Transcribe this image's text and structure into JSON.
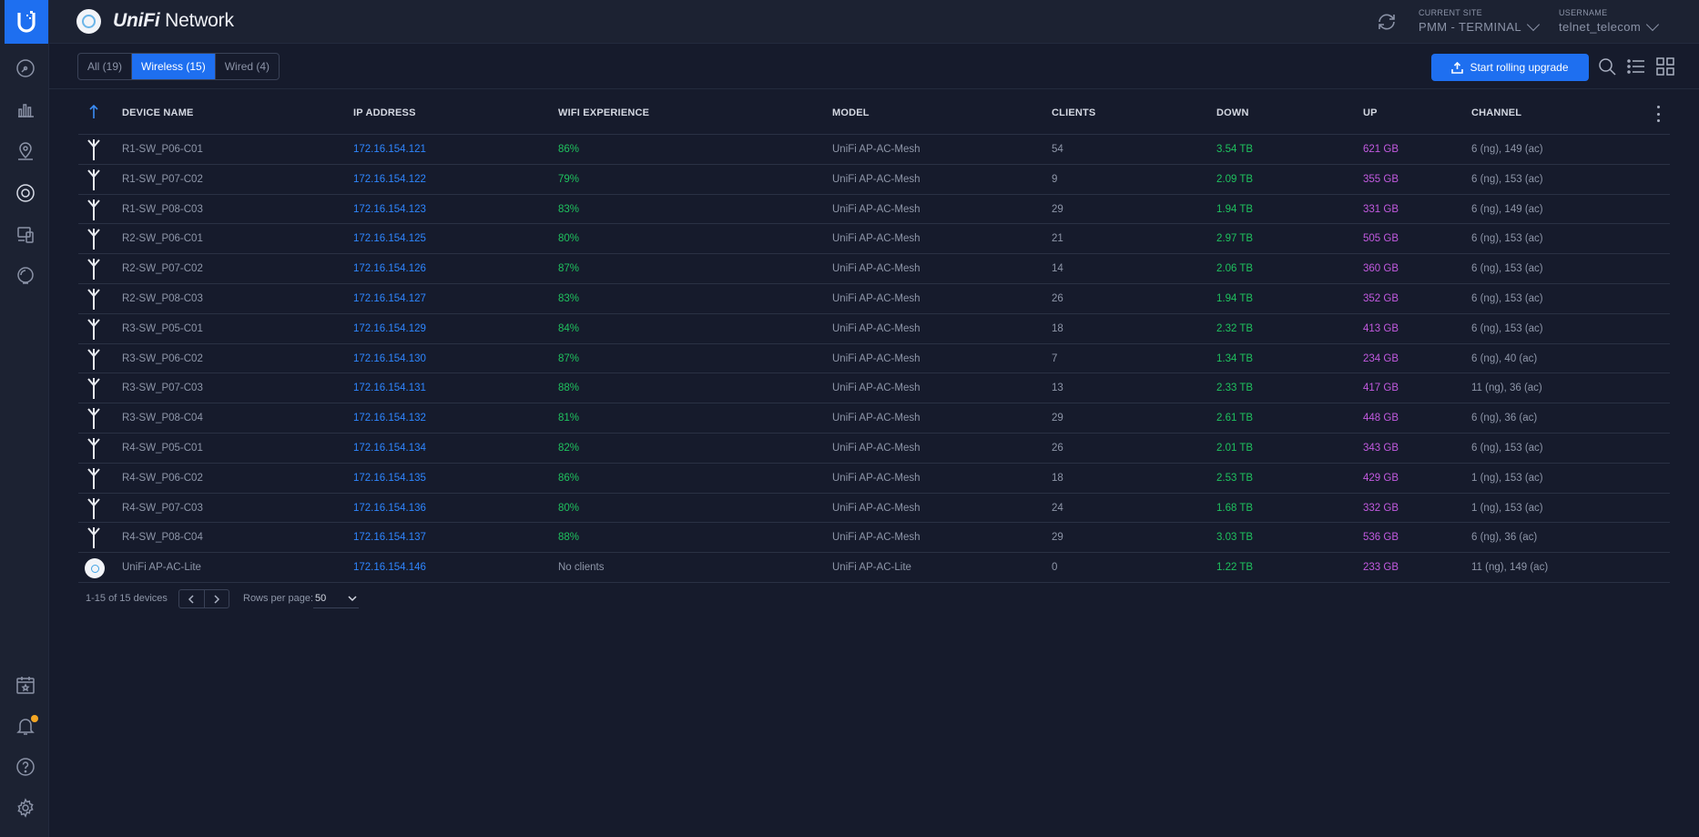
{
  "header": {
    "brand_prefix": "UniFi",
    "brand_suffix": " Network",
    "site_label": "CURRENT SITE",
    "site_value": "PMM - TERMINAL",
    "user_label": "USERNAME",
    "user_value": "telnet_telecom"
  },
  "toolbar": {
    "tabs": [
      {
        "label": "All (19)",
        "active": false
      },
      {
        "label": "Wireless (15)",
        "active": true
      },
      {
        "label": "Wired (4)",
        "active": false
      }
    ],
    "upgrade_label": "Start rolling upgrade"
  },
  "table": {
    "columns": [
      "DEVICE NAME",
      "IP ADDRESS",
      "WIFI EXPERIENCE",
      "MODEL",
      "CLIENTS",
      "DOWN",
      "UP",
      "CHANNEL"
    ],
    "rows": [
      {
        "icon": "antenna-icon",
        "name": "R1-SW_P06-C01",
        "ip": "172.16.154.121",
        "wifi": "86%",
        "model": "UniFi AP-AC-Mesh",
        "clients": "54",
        "down": "3.54 TB",
        "up": "621 GB",
        "channel": "6 (ng), 149 (ac)"
      },
      {
        "icon": "antenna-icon",
        "name": "R1-SW_P07-C02",
        "ip": "172.16.154.122",
        "wifi": "79%",
        "model": "UniFi AP-AC-Mesh",
        "clients": "9",
        "down": "2.09 TB",
        "up": "355 GB",
        "channel": "6 (ng), 153 (ac)"
      },
      {
        "icon": "antenna-icon",
        "name": "R1-SW_P08-C03",
        "ip": "172.16.154.123",
        "wifi": "83%",
        "model": "UniFi AP-AC-Mesh",
        "clients": "29",
        "down": "1.94 TB",
        "up": "331 GB",
        "channel": "6 (ng), 149 (ac)"
      },
      {
        "icon": "antenna-icon",
        "name": "R2-SW_P06-C01",
        "ip": "172.16.154.125",
        "wifi": "80%",
        "model": "UniFi AP-AC-Mesh",
        "clients": "21",
        "down": "2.97 TB",
        "up": "505 GB",
        "channel": "6 (ng), 153 (ac)"
      },
      {
        "icon": "antenna-icon",
        "name": "R2-SW_P07-C02",
        "ip": "172.16.154.126",
        "wifi": "87%",
        "model": "UniFi AP-AC-Mesh",
        "clients": "14",
        "down": "2.06 TB",
        "up": "360 GB",
        "channel": "6 (ng), 153 (ac)"
      },
      {
        "icon": "antenna-icon",
        "name": "R2-SW_P08-C03",
        "ip": "172.16.154.127",
        "wifi": "83%",
        "model": "UniFi AP-AC-Mesh",
        "clients": "26",
        "down": "1.94 TB",
        "up": "352 GB",
        "channel": "6 (ng), 153 (ac)"
      },
      {
        "icon": "antenna-icon",
        "name": "R3-SW_P05-C01",
        "ip": "172.16.154.129",
        "wifi": "84%",
        "model": "UniFi AP-AC-Mesh",
        "clients": "18",
        "down": "2.32 TB",
        "up": "413 GB",
        "channel": "6 (ng), 153 (ac)"
      },
      {
        "icon": "antenna-icon",
        "name": "R3-SW_P06-C02",
        "ip": "172.16.154.130",
        "wifi": "87%",
        "model": "UniFi AP-AC-Mesh",
        "clients": "7",
        "down": "1.34 TB",
        "up": "234 GB",
        "channel": "6 (ng), 40 (ac)"
      },
      {
        "icon": "antenna-icon",
        "name": "R3-SW_P07-C03",
        "ip": "172.16.154.131",
        "wifi": "88%",
        "model": "UniFi AP-AC-Mesh",
        "clients": "13",
        "down": "2.33 TB",
        "up": "417 GB",
        "channel": "11 (ng), 36 (ac)"
      },
      {
        "icon": "antenna-icon",
        "name": "R3-SW_P08-C04",
        "ip": "172.16.154.132",
        "wifi": "81%",
        "model": "UniFi AP-AC-Mesh",
        "clients": "29",
        "down": "2.61 TB",
        "up": "448 GB",
        "channel": "6 (ng), 36 (ac)"
      },
      {
        "icon": "antenna-icon",
        "name": "R4-SW_P05-C01",
        "ip": "172.16.154.134",
        "wifi": "82%",
        "model": "UniFi AP-AC-Mesh",
        "clients": "26",
        "down": "2.01 TB",
        "up": "343 GB",
        "channel": "6 (ng), 153 (ac)"
      },
      {
        "icon": "antenna-icon",
        "name": "R4-SW_P06-C02",
        "ip": "172.16.154.135",
        "wifi": "86%",
        "model": "UniFi AP-AC-Mesh",
        "clients": "18",
        "down": "2.53 TB",
        "up": "429 GB",
        "channel": "1 (ng), 153 (ac)"
      },
      {
        "icon": "antenna-icon",
        "name": "R4-SW_P07-C03",
        "ip": "172.16.154.136",
        "wifi": "80%",
        "model": "UniFi AP-AC-Mesh",
        "clients": "24",
        "down": "1.68 TB",
        "up": "332 GB",
        "channel": "1 (ng), 153 (ac)"
      },
      {
        "icon": "antenna-icon",
        "name": "R4-SW_P08-C04",
        "ip": "172.16.154.137",
        "wifi": "88%",
        "model": "UniFi AP-AC-Mesh",
        "clients": "29",
        "down": "3.03 TB",
        "up": "536 GB",
        "channel": "6 (ng), 36 (ac)"
      },
      {
        "icon": "access-point-icon",
        "name": "UniFi AP-AC-Lite",
        "ip": "172.16.154.146",
        "wifi": "No clients",
        "model": "UniFi AP-AC-Lite",
        "clients": "0",
        "down": "1.22 TB",
        "up": "233 GB",
        "channel": "11 (ng), 149 (ac)"
      }
    ]
  },
  "pager": {
    "range_text": "1-15 of 15 devices",
    "rows_per_page_label": "Rows per page:",
    "rows_per_page_value": "50"
  },
  "colors": {
    "accent": "#1e6ff0",
    "ip": "#2e86ff",
    "positive": "#1fc25e",
    "upload": "#c25ae0",
    "notification": "#f5a623"
  }
}
